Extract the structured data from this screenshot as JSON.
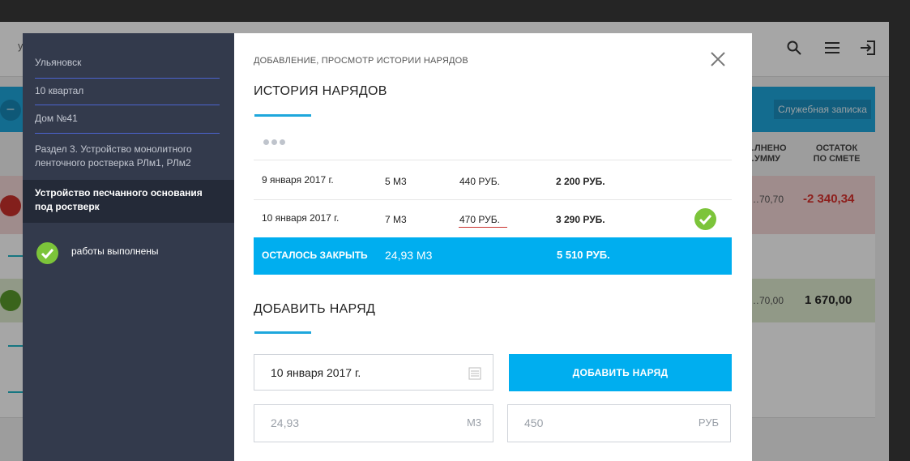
{
  "background": {
    "header_fragment": "у",
    "memo_button": "Служебная записка",
    "collapse_symbol": "–",
    "col_spent": "…ЛНЕНО\n…УММУ",
    "col_remaining": "ОСТАТОК\nПО СМЕТЕ",
    "row1_partial": "…70,70",
    "row1_remaining": "-2 340,34",
    "row2_partial": "…70,00",
    "row2_remaining": "1 670,00"
  },
  "sidebar": {
    "city": "Ульяновск",
    "quarter": "10 квартал",
    "house": "Дом №41",
    "section": "Раздел 3. Устройство монолитного ленточного ростверка РЛм1, РЛм2",
    "active_item": "Устройство песчанного основания под ростверк",
    "status": "работы выполнены"
  },
  "modal": {
    "eyebrow": "ДОБАВЛЕНИЕ, ПРОСМОТР ИСТОРИИ НАРЯДОВ",
    "history_title": "ИСТОРИЯ НАРЯДОВ",
    "history": [
      {
        "date": "9 января 2017 г.",
        "qty": "5 М3",
        "price": "440 РУБ.",
        "sum": "2 200 РУБ.",
        "closed": false
      },
      {
        "date": "10 января 2017 г.",
        "qty": "7 М3",
        "price": "470 РУБ.",
        "sum": "3 290 РУБ.",
        "closed": true
      }
    ],
    "total": {
      "label": "ОСТАЛОСЬ ЗАКРЫТЬ",
      "qty": "24,93 М3",
      "sum": "5 510 РУБ."
    },
    "add_title": "ДОБАВИТЬ НАРЯД",
    "form": {
      "date_value": "10 января 2017 г.",
      "add_button": "ДОБАВИТЬ НАРЯД",
      "qty_placeholder": "24,93",
      "qty_unit": "М3",
      "price_placeholder": "450",
      "price_unit": "РУБ"
    }
  },
  "colors": {
    "accent": "#00aeef",
    "success": "#7cc43a",
    "error": "#c9302c",
    "sidebar_bg": "#333a4c"
  }
}
